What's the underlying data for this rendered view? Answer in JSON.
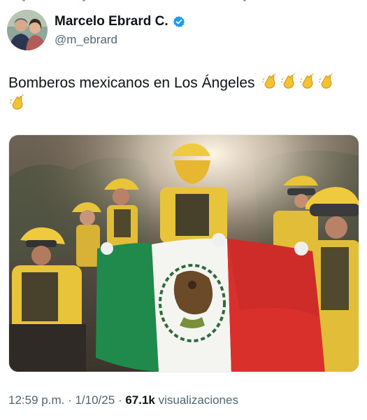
{
  "author": {
    "display_name": "Marcelo Ebrard C.",
    "handle": "@m_ebrard",
    "verified": true
  },
  "tweet": {
    "text": "Bomberos mexicanos en Los Ángeles",
    "emoji": [
      "clapping-hands",
      "clapping-hands",
      "clapping-hands",
      "clapping-hands",
      "clapping-hands"
    ]
  },
  "media": {
    "type": "photo",
    "alt": ""
  },
  "meta": {
    "time": "12:59 p.m.",
    "separator": "·",
    "date": "1/10/25",
    "views_count": "67.1k",
    "views_label": "visualizaciones"
  },
  "colors": {
    "text_primary": "#0f1419",
    "text_secondary": "#536471",
    "verified_blue": "#1d9bf0",
    "flag_green": "#1f8a4c",
    "flag_white": "#f4f4f0",
    "flag_red": "#d9302c",
    "firefighter_yellow": "#e8c43a"
  },
  "icons": {
    "verified": "verified-badge-icon",
    "clap": "clapping-hands-icon"
  }
}
